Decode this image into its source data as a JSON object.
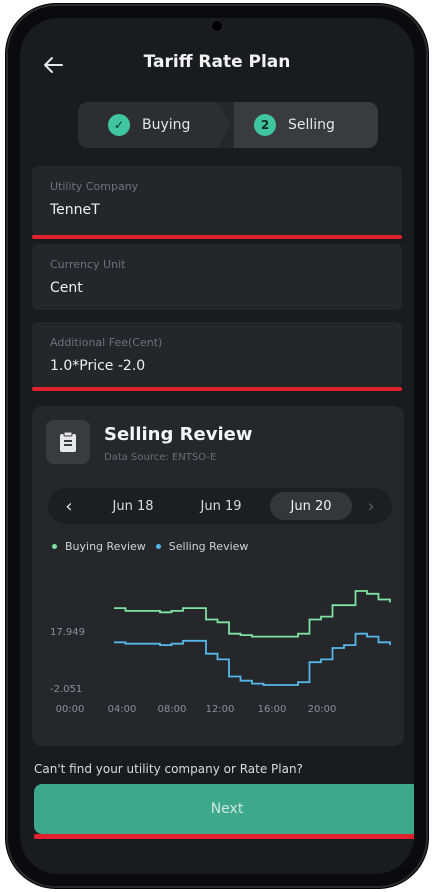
{
  "header": {
    "title": "Tariff Rate Plan"
  },
  "stepper": {
    "steps": [
      {
        "label": "Buying",
        "badge": "✓"
      },
      {
        "label": "Selling",
        "badge": "2"
      }
    ]
  },
  "fields": {
    "utility": {
      "label": "Utility Company",
      "value": "TenneT"
    },
    "currency": {
      "label": "Currency Unit",
      "value": "Cent"
    },
    "fee": {
      "label": "Additional Fee(Cent)",
      "value": "1.0*Price -2.0"
    }
  },
  "review": {
    "title": "Selling Review",
    "source": "Data Source: ENTSO-E",
    "dates": [
      "Jun 18",
      "Jun 19",
      "Jun 20"
    ],
    "selected_date": "Jun 20"
  },
  "chart_data": {
    "type": "line",
    "title": "",
    "xlabel": "",
    "ylabel": "",
    "x_tick_labels": [
      "00:00",
      "04:00",
      "08:00",
      "12:00",
      "16:00",
      "20:00"
    ],
    "y_tick_labels": [
      "17.949",
      "-2.051"
    ],
    "ylim": [
      -2.051,
      37.949
    ],
    "xlim": [
      0,
      24
    ],
    "legend": "top-left",
    "series": [
      {
        "name": "Buying Review",
        "color": "#7fe3a2",
        "x": [
          0,
          1,
          2,
          3,
          4,
          5,
          6,
          7,
          8,
          9,
          10,
          11,
          12,
          13,
          14,
          15,
          16,
          17,
          18,
          19,
          20,
          21,
          22,
          23,
          24
        ],
        "values": [
          26,
          25,
          25,
          25,
          24.5,
          25,
          26,
          26,
          22,
          21,
          17,
          16.5,
          16,
          16,
          16,
          16,
          17,
          22,
          23,
          27,
          27,
          32,
          31,
          29,
          28
        ]
      },
      {
        "name": "Selling Review",
        "color": "#54b9ea",
        "x": [
          0,
          1,
          2,
          3,
          4,
          5,
          6,
          7,
          8,
          9,
          10,
          11,
          12,
          13,
          14,
          15,
          16,
          17,
          18,
          19,
          20,
          21,
          22,
          23,
          24
        ],
        "values": [
          14,
          13.5,
          13.5,
          13.5,
          13,
          13.5,
          14.5,
          14.5,
          10,
          8,
          2,
          0.5,
          -0.5,
          -1,
          -1,
          -1,
          0,
          7,
          8,
          12,
          13,
          17,
          16,
          14,
          13
        ]
      }
    ]
  },
  "footer": {
    "prompt": "Can't find your utility company or Rate Plan?",
    "next_label": "Next"
  },
  "colors": {
    "accent": "#3fc6a0",
    "highlight": "#e0222e",
    "background": "#1a1b1e"
  }
}
